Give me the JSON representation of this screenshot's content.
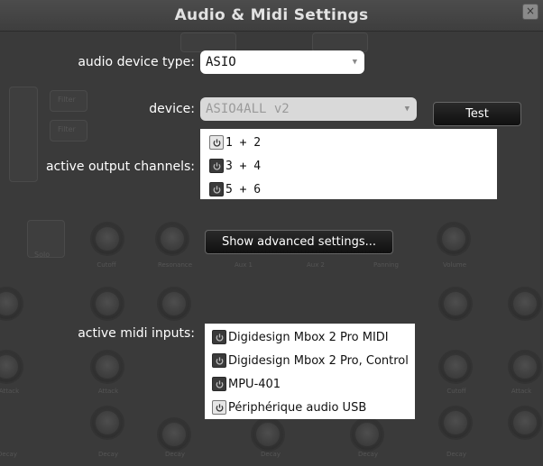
{
  "window": {
    "title": "Audio & Midi Settings",
    "close_glyph": "×"
  },
  "audio_device_type": {
    "label": "audio device type:",
    "value": "ASIO"
  },
  "device": {
    "label": "device:",
    "value": "ASIO4ALL v2",
    "test_button": "Test"
  },
  "output_channels": {
    "label": "active output channels:",
    "items": [
      {
        "label": "1 + 2",
        "enabled": true
      },
      {
        "label": "3 + 4",
        "enabled": false
      },
      {
        "label": "5 + 6",
        "enabled": false
      }
    ]
  },
  "advanced_button": "Show advanced settings...",
  "midi_inputs": {
    "label": "active midi inputs:",
    "items": [
      {
        "label": "Digidesign Mbox 2 Pro MIDI",
        "enabled": false
      },
      {
        "label": "Digidesign Mbox 2 Pro, Control",
        "enabled": false
      },
      {
        "label": "MPU-401",
        "enabled": false
      },
      {
        "label": "Périphérique audio USB",
        "enabled": true
      }
    ]
  },
  "background": {
    "knob_labels": [
      "Cutoff",
      "Resonance",
      "Aux 1",
      "Aux 2",
      "Panning",
      "Volume"
    ],
    "lower_labels": [
      "Attack",
      "Attack",
      "Cutoff",
      "Attack",
      "Decay",
      "Decay",
      "Decay",
      "Decay",
      "Decay",
      "Decay"
    ],
    "buttons": [
      "Filter",
      "Filter",
      "Solo",
      "Mute"
    ]
  },
  "colors": {
    "dialog_bg": "#3a3a3a",
    "label_text": "#ffffff",
    "button_bg": "#111111"
  },
  "icons": {
    "power": "power-icon",
    "dropdown": "chevron-down-icon",
    "close": "close-icon"
  }
}
